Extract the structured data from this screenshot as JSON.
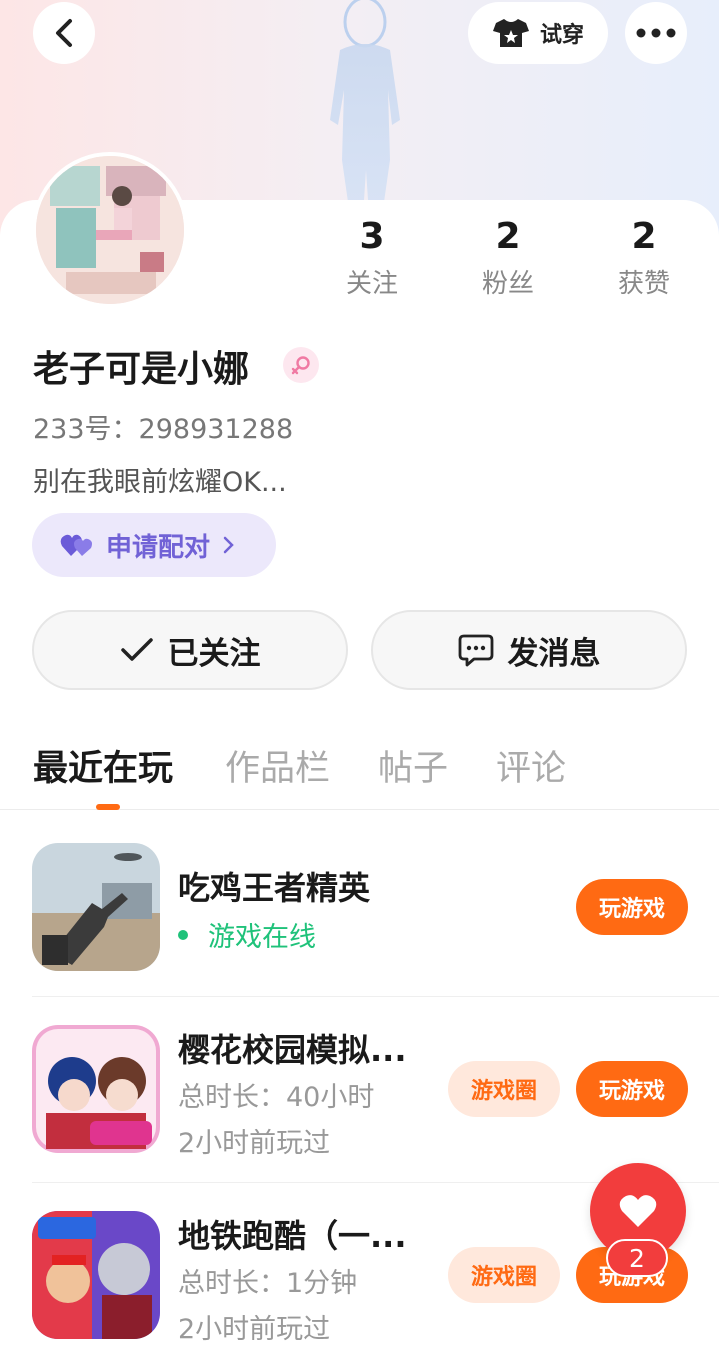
{
  "header": {
    "tryon_label": "试穿"
  },
  "profile": {
    "nickname": "老子可是小娜",
    "uid": "233号：298931288",
    "bio": "别在我眼前炫耀OK...",
    "pair_label": "申请配对",
    "stats": [
      {
        "value": "3",
        "label": "关注"
      },
      {
        "value": "2",
        "label": "粉丝"
      },
      {
        "value": "2",
        "label": "获赞"
      }
    ],
    "follow_label": "已关注",
    "message_label": "发消息"
  },
  "tabs": [
    {
      "label": "最近在玩",
      "active": true
    },
    {
      "label": "作品栏",
      "active": false
    },
    {
      "label": "帖子",
      "active": false
    },
    {
      "label": "评论",
      "active": false
    }
  ],
  "games": [
    {
      "title": "吃鸡王者精英",
      "status": "游戏在线",
      "play_label": "玩游戏"
    },
    {
      "title": "樱花校园模拟...",
      "duration": "总时长：40小时",
      "last_played": "2小时前玩过",
      "circle_label": "游戏圈",
      "play_label": "玩游戏"
    },
    {
      "title": "地铁跑酷（一...",
      "duration": "总时长：1分钟",
      "last_played": "2小时前玩过",
      "circle_label": "游戏圈",
      "play_label": "玩游戏"
    }
  ],
  "floating": {
    "like_count": "2"
  },
  "colors": {
    "accent": "#ff6a13",
    "online": "#1fc27a",
    "pair": "#7162d6",
    "like": "#f23d3d"
  }
}
